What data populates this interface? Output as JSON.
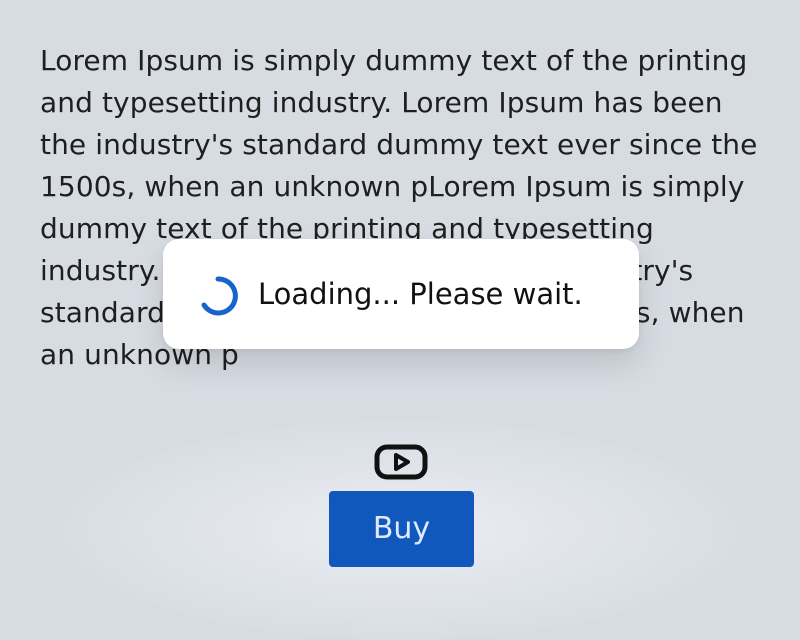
{
  "article": {
    "paragraph": "Lorem Ipsum is simply dummy text of the printing and typesetting industry. Lorem Ipsum has been the industry's standard dummy text ever since the 1500s, when an unknown pLorem Ipsum is simply dummy text of the printing and typesetting industry. Lorem Ipsum has been the industry's standard dummy text ever since the 1500s, when an unknown p"
  },
  "media": {
    "icon": "play-video-icon"
  },
  "actions": {
    "buy_label": "Buy"
  },
  "loading": {
    "message": "Loading... Please wait.",
    "spinner_icon": "spinner-icon"
  },
  "colors": {
    "background": "#d7dce3",
    "button": "#1158bd",
    "spinner": "#1a64c9"
  }
}
